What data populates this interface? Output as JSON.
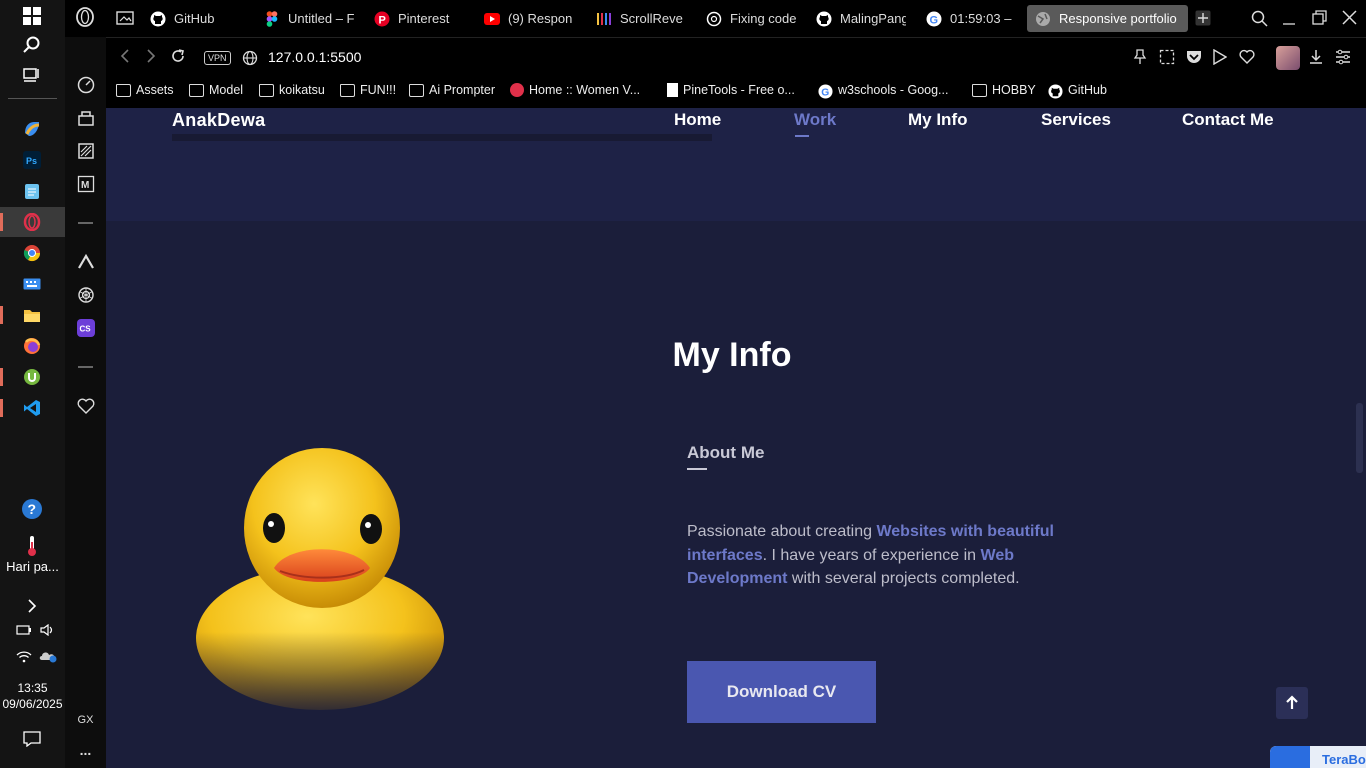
{
  "tabs": [
    {
      "label": "GitHub"
    },
    {
      "label": "Untitled – F"
    },
    {
      "label": "Pinterest"
    },
    {
      "label": "(9) Respon"
    },
    {
      "label": "ScrollReve"
    },
    {
      "label": "Fixing code"
    },
    {
      "label": "MalingPang"
    },
    {
      "label": "01:59:03 –"
    },
    {
      "label": "Responsive portfolio"
    }
  ],
  "address": {
    "vpn_badge": "VPN",
    "url": "127.0.0.1:5500"
  },
  "bookmarks": [
    {
      "label": "Assets"
    },
    {
      "label": "Model"
    },
    {
      "label": "koikatsu"
    },
    {
      "label": "FUN!!!"
    },
    {
      "label": "Ai Prompter"
    },
    {
      "label": "Home :: Women V..."
    },
    {
      "label": "PineTools - Free o..."
    },
    {
      "label": "w3schools - Goog..."
    },
    {
      "label": "HOBBY"
    },
    {
      "label": "GitHub"
    }
  ],
  "taskbar": {
    "weather_label": "Hari pa...",
    "time": "13:35",
    "date": "09/06/2025"
  },
  "gx_sidebar": {
    "gx_label": "GX",
    "more_label": "..."
  },
  "site": {
    "brand": "AnakDewa",
    "nav": [
      {
        "label": "Home"
      },
      {
        "label": "Work"
      },
      {
        "label": "My Info"
      },
      {
        "label": "Services"
      },
      {
        "label": "Contact Me"
      }
    ],
    "section_title": "My Info",
    "about_title": "About Me",
    "about_text": {
      "part1": "Passionate about creating ",
      "highlight1": "Websites with beautiful interfaces",
      "part2": ". I have years of experience in ",
      "highlight2": "Web Development",
      "part3": " with several projects completed."
    },
    "cv_button": "Download CV",
    "scroll_top_icon": "arrow-up-icon",
    "terabox_label": "TeraBox"
  },
  "colors": {
    "page_bg": "#1b1e3a",
    "header_bg": "#1e2246",
    "accent": "#6d79c9",
    "button": "#4a57b0"
  }
}
